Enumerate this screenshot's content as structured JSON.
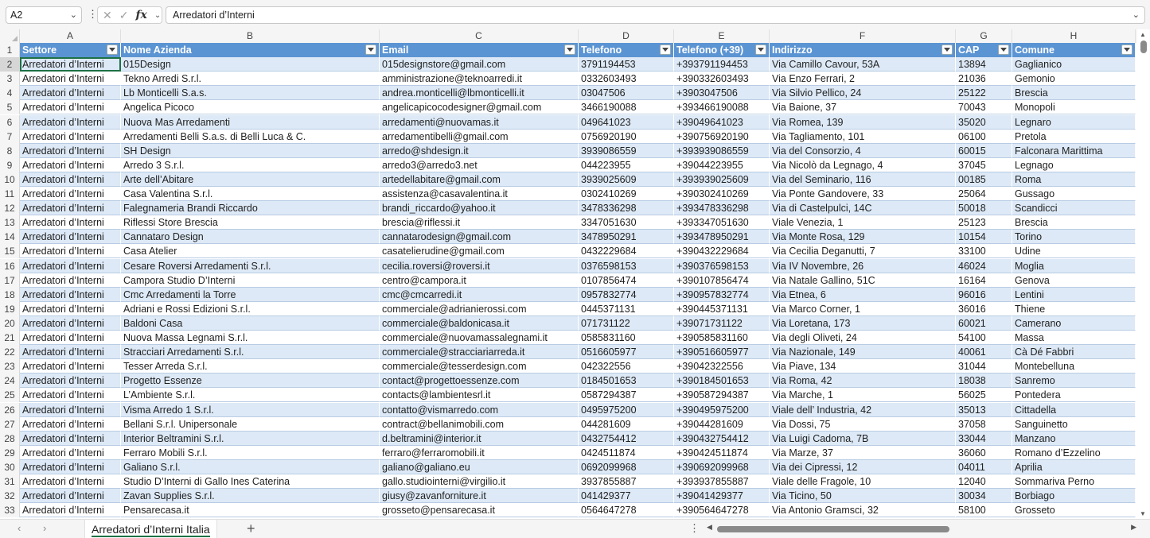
{
  "formula_bar": {
    "name_box": "A2",
    "formula": "Arredatori d’Interni"
  },
  "columns": [
    "A",
    "B",
    "C",
    "D",
    "E",
    "F",
    "G",
    "H"
  ],
  "table": {
    "headers": [
      "Settore",
      "Nome Azienda",
      "Email",
      "Telefono",
      "Telefono (+39)",
      "Indirizzo",
      "CAP",
      "Comune"
    ],
    "rows": [
      [
        "Arredatori d’Interni",
        "015Design",
        "015designstore@gmail.com",
        "3791194453",
        "+393791194453",
        "Via Camillo Cavour, 53A",
        "13894",
        "Gaglianico"
      ],
      [
        "Arredatori d’Interni",
        "Tekno Arredi S.r.l.",
        "amministrazione@teknoarredi.it",
        "0332603493",
        "+390332603493",
        "Via Enzo Ferrari, 2",
        "21036",
        "Gemonio"
      ],
      [
        "Arredatori d’Interni",
        "Lb Monticelli S.a.s.",
        "andrea.monticelli@lbmonticelli.it",
        "03047506",
        "+3903047506",
        "Via Silvio Pellico, 24",
        "25122",
        "Brescia"
      ],
      [
        "Arredatori d’Interni",
        "Angelica Picoco",
        "angelicapicocodesigner@gmail.com",
        "3466190088",
        "+393466190088",
        "Via Baione, 37",
        "70043",
        "Monopoli"
      ],
      [
        "Arredatori d’Interni",
        "Nuova Mas Arredamenti",
        "arredamenti@nuovamas.it",
        "049641023",
        "+39049641023",
        "Via Romea, 139",
        "35020",
        "Legnaro"
      ],
      [
        "Arredatori d’Interni",
        "Arredamenti Belli S.a.s. di Belli Luca & C.",
        "arredamentibelli@gmail.com",
        "0756920190",
        "+390756920190",
        "Via Tagliamento, 101",
        "06100",
        "Pretola"
      ],
      [
        "Arredatori d’Interni",
        "SH Design",
        "arredo@shdesign.it",
        "3939086559",
        "+393939086559",
        "Via del Consorzio, 4",
        "60015",
        "Falconara Marittima"
      ],
      [
        "Arredatori d’Interni",
        "Arredo 3 S.r.l.",
        "arredo3@arredo3.net",
        "044223955",
        "+39044223955",
        "Via Nicolò da Legnago, 4",
        "37045",
        "Legnago"
      ],
      [
        "Arredatori d’Interni",
        "Arte dell’Abitare",
        "artedellabitare@gmail.com",
        "3939025609",
        "+393939025609",
        "Via del Seminario, 116",
        "00185",
        "Roma"
      ],
      [
        "Arredatori d’Interni",
        "Casa Valentina S.r.l.",
        "assistenza@casavalentina.it",
        "0302410269",
        "+390302410269",
        "Via Ponte Gandovere, 33",
        "25064",
        "Gussago"
      ],
      [
        "Arredatori d’Interni",
        "Falegnameria Brandi Riccardo",
        "brandi_riccardo@yahoo.it",
        "3478336298",
        "+393478336298",
        "Via di Castelpulci, 14C",
        "50018",
        "Scandicci"
      ],
      [
        "Arredatori d’Interni",
        "Riflessi Store Brescia",
        "brescia@riflessi.it",
        "3347051630",
        "+393347051630",
        "Viale Venezia, 1",
        "25123",
        "Brescia"
      ],
      [
        "Arredatori d’Interni",
        "Cannataro Design",
        "cannatarodesign@gmail.com",
        "3478950291",
        "+393478950291",
        "Via Monte Rosa, 129",
        "10154",
        "Torino"
      ],
      [
        "Arredatori d’Interni",
        "Casa Atelier",
        "casatelierudine@gmail.com",
        "0432229684",
        "+390432229684",
        "Via Cecilia Deganutti, 7",
        "33100",
        "Udine"
      ],
      [
        "Arredatori d’Interni",
        "Cesare Roversi Arredamenti S.r.l.",
        "cecilia.roversi@roversi.it",
        "0376598153",
        "+390376598153",
        "Via IV Novembre, 26",
        "46024",
        "Moglia"
      ],
      [
        "Arredatori d’Interni",
        "Campora Studio D’Interni",
        "centro@campora.it",
        "0107856474",
        "+390107856474",
        "Via Natale Gallino, 51C",
        "16164",
        "Genova"
      ],
      [
        "Arredatori d’Interni",
        "Cmc Arredamenti la Torre",
        "cmc@cmcarredi.it",
        "0957832774",
        "+390957832774",
        "Via Etnea, 6",
        "96016",
        "Lentini"
      ],
      [
        "Arredatori d’Interni",
        "Adriani e Rossi Edizioni S.r.l.",
        "commerciale@adrianierossi.com",
        "0445371131",
        "+390445371131",
        "Via Marco Corner, 1",
        "36016",
        "Thiene"
      ],
      [
        "Arredatori d’Interni",
        "Baldoni Casa",
        "commerciale@baldonicasa.it",
        "071731122",
        "+39071731122",
        "Via Loretana, 173",
        "60021",
        "Camerano"
      ],
      [
        "Arredatori d’Interni",
        "Nuova Massa Legnami S.r.l.",
        "commerciale@nuovamassalegnami.it",
        "0585831160",
        "+390585831160",
        "Via degli Oliveti, 24",
        "54100",
        "Massa"
      ],
      [
        "Arredatori d’Interni",
        "Stracciari Arredamenti S.r.l.",
        "commerciale@stracciariarreda.it",
        "0516605977",
        "+390516605977",
        "Via Nazionale, 149",
        "40061",
        "Cà Dé Fabbri"
      ],
      [
        "Arredatori d’Interni",
        "Tesser Arreda S.r.l.",
        "commerciale@tesserdesign.com",
        "042322556",
        "+39042322556",
        "Via Piave, 134",
        "31044",
        "Montebelluna"
      ],
      [
        "Arredatori d’Interni",
        "Progetto Essenze",
        "contact@progettoessenze.com",
        "0184501653",
        "+390184501653",
        "Via Roma, 42",
        "18038",
        "Sanremo"
      ],
      [
        "Arredatori d’Interni",
        "L’Ambiente S.r.l.",
        "contacts@lambientesrl.it",
        "0587294387",
        "+390587294387",
        "Via Marche, 1",
        "56025",
        "Pontedera"
      ],
      [
        "Arredatori d’Interni",
        "Visma Arredo 1 S.r.l.",
        "contatto@vismarredo.com",
        "0495975200",
        "+390495975200",
        "Viale dell’ Industria, 42",
        "35013",
        "Cittadella"
      ],
      [
        "Arredatori d’Interni",
        "Bellani S.r.l. Unipersonale",
        "contract@bellanimobili.com",
        "044281609",
        "+39044281609",
        "Via Dossi, 75",
        "37058",
        "Sanguinetto"
      ],
      [
        "Arredatori d’Interni",
        "Interior Beltramini S.r.l.",
        "d.beltramini@interior.it",
        "0432754412",
        "+390432754412",
        "Via Luigi Cadorna, 7B",
        "33044",
        "Manzano"
      ],
      [
        "Arredatori d’Interni",
        "Ferraro Mobili S.r.l.",
        "ferraro@ferraromobili.it",
        "0424511874",
        "+390424511874",
        "Via Marze, 37",
        "36060",
        "Romano d’Ezzelino"
      ],
      [
        "Arredatori d’Interni",
        "Galiano S.r.l.",
        "galiano@galiano.eu",
        "0692099968",
        "+390692099968",
        "Via dei Cipressi, 12",
        "04011",
        "Aprilia"
      ],
      [
        "Arredatori d’Interni",
        "Studio D’Interni di Gallo Ines Caterina",
        "gallo.studiointerni@virgilio.it",
        "3937855887",
        "+393937855887",
        "Viale delle Fragole, 10",
        "12040",
        "Sommariva Perno"
      ],
      [
        "Arredatori d’Interni",
        "Zavan Supplies S.r.l.",
        "giusy@zavanforniture.it",
        "041429377",
        "+39041429377",
        "Via Ticino, 50",
        "30034",
        "Borbiago"
      ],
      [
        "Arredatori d’Interni",
        "Pensarecasa.it",
        "grosseto@pensarecasa.it",
        "0564647278",
        "+390564647278",
        "Via Antonio Gramsci, 32",
        "58100",
        "Grosseto"
      ]
    ]
  },
  "sheet_tabs": [
    "Arredatori d’Interni Italia"
  ],
  "icons": {
    "name_box_dropdown": "chevron-down-icon",
    "cancel": "x-icon",
    "confirm": "check-icon",
    "insert_function": "fx-icon",
    "add_sheet": "plus-icon"
  }
}
